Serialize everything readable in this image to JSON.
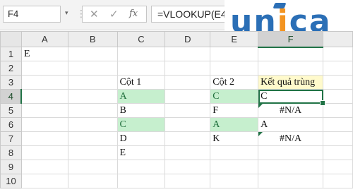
{
  "name_box": "F4",
  "name_box_arrow": "▾",
  "formula_bar": {
    "cancel_icon": "✕",
    "enter_icon": "✓",
    "fx_label": "fx",
    "formula": "=VLOOKUP(E4"
  },
  "logo": {
    "text_u": "u",
    "text_n": "n",
    "text_i": "i",
    "text_c": "c",
    "text_a": "a",
    "brand_color": "#2b6fb6",
    "accent_color": "#f39421"
  },
  "columns": [
    "A",
    "B",
    "C",
    "D",
    "E",
    "F"
  ],
  "selected_column": "F",
  "rows": [
    "1",
    "2",
    "3",
    "4",
    "5",
    "6",
    "7",
    "8",
    "9",
    "10"
  ],
  "selected_row": "4",
  "cells": {
    "A1": "E",
    "C3": "Cột 1",
    "C4": "A",
    "C5": "B",
    "C6": "C",
    "C7": "D",
    "C8": "E",
    "E3": "Cột 2",
    "E4": "C",
    "E5": "F",
    "E6": "A",
    "E7": "K",
    "F3": "Kết quả trùng",
    "F4": "C",
    "F5": "#N/A",
    "F6": "A",
    "F7": "#N/A"
  },
  "colors": {
    "match_fill": "#c6efce",
    "header_fill": "#fffacc",
    "selection": "#217346"
  }
}
